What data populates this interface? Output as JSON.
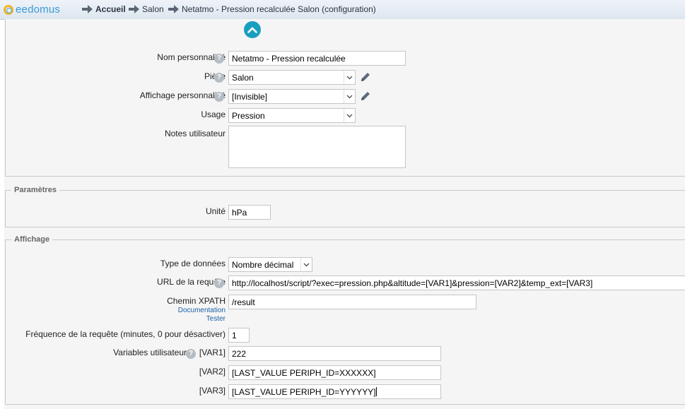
{
  "header": {
    "logo_text": "eedomus",
    "breadcrumbs": [
      {
        "label": "Accueil"
      },
      {
        "label": "Salon"
      },
      {
        "label": "Netatmo - Pression recalculée Salon (configuration)"
      }
    ]
  },
  "general": {
    "nom_label": "Nom personnalisé",
    "nom_value": "Netatmo - Pression recalculée",
    "piece_label": "Pièce",
    "piece_value": "Salon",
    "affichage_label": "Affichage personnalisé",
    "affichage_value": "[Invisible]",
    "usage_label": "Usage",
    "usage_value": "Pression",
    "notes_label": "Notes utilisateur",
    "notes_value": ""
  },
  "parametres": {
    "legend": "Paramètres",
    "unite_label": "Unité",
    "unite_value": "hPa"
  },
  "affichage": {
    "legend": "Affichage",
    "type_label": "Type de données",
    "type_value": "Nombre décimal",
    "url_label": "URL de la requête",
    "url_value": "http://localhost/script/?exec=pression.php&altitude=[VAR1]&pression=[VAR2]&temp_ext=[VAR3]",
    "xpath_label": "Chemin XPATH",
    "xpath_value": "/result",
    "doc_link": "Documentation",
    "test_link": "Tester",
    "freq_label": "Fréquence de la requête (minutes, 0 pour désactiver)",
    "freq_value": "1",
    "vars_label": "Variables utilisateur",
    "var1_label": "[VAR1]",
    "var1_value": "222",
    "var2_label": "[VAR2]",
    "var2_value": "[LAST_VALUE PERIPH_ID=XXXXXX]",
    "var3_label": "[VAR3]",
    "var3_value": "[LAST_VALUE PERIPH_ID=YYYYYY]"
  },
  "icons": {
    "help_glyph": "?",
    "accent_color": "#1a9ec0"
  }
}
